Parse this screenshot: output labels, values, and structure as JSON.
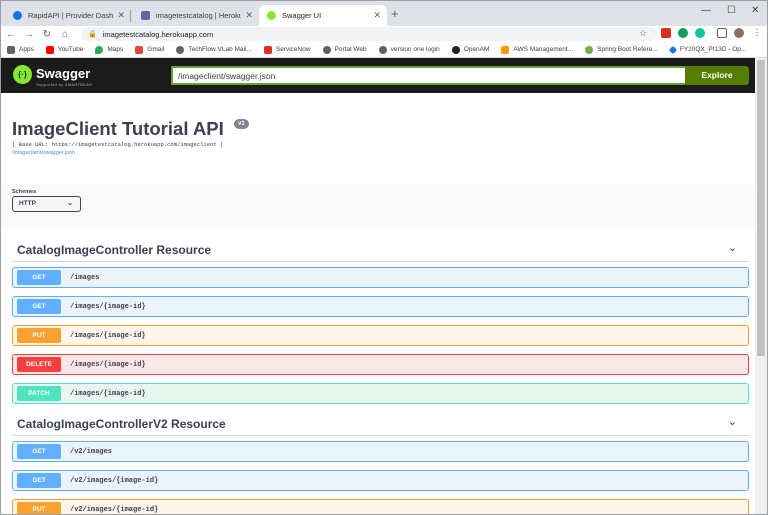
{
  "browser": {
    "tabs": [
      {
        "title": "RapidAPI | Provider Dashboard",
        "icon": "rapidapi-icon",
        "color": "#1a73e8"
      },
      {
        "title": "imagetestcatalog | Heroku",
        "icon": "heroku-icon",
        "color": "#6762a6"
      },
      {
        "title": "Swagger UI",
        "icon": "swagger-icon",
        "color": "#85ea2d"
      }
    ],
    "new_tab": "+",
    "window_controls": {
      "minimize": "—",
      "maximize": "☐",
      "close": "✕"
    },
    "nav": {
      "back": "←",
      "forward": "→",
      "reload": "↻",
      "home": "⌂"
    },
    "url": "imagetestcatalog.herokuapp.com"
  },
  "bookmarks": [
    {
      "label": "Apps",
      "icon": "apps-grid-icon",
      "color": "#5f6368"
    },
    {
      "label": "YouTube",
      "icon": "youtube-icon",
      "color": "#ff0000"
    },
    {
      "label": "Maps",
      "icon": "maps-icon",
      "color": "#34a853"
    },
    {
      "label": "Gmail",
      "icon": "gmail-icon",
      "color": "#ea4335"
    },
    {
      "label": "TechFlow VLab Mail...",
      "icon": "globe-icon",
      "color": "#5f6368"
    },
    {
      "label": "ServiceNow",
      "icon": "servicenow-icon",
      "color": "#d93025"
    },
    {
      "label": "Portal Web",
      "icon": "globe-icon",
      "color": "#5f6368"
    },
    {
      "label": "version one login",
      "icon": "globe-icon",
      "color": "#5f6368"
    },
    {
      "label": "OpenAM",
      "icon": "openam-icon",
      "color": "#202124"
    },
    {
      "label": "AWS Management...",
      "icon": "aws-icon",
      "color": "#ff9900"
    },
    {
      "label": "Spring Boot Refere...",
      "icon": "spring-icon",
      "color": "#6db33f"
    },
    {
      "label": "FY20QX_PI13D - Op...",
      "icon": "diamond-icon",
      "color": "#1a73e8"
    }
  ],
  "swagger": {
    "brand": "Swagger",
    "brand_sub": "Supported by SMARTBEAR",
    "spec_url": "/imageclient/swagger.json",
    "explore_label": "Explore"
  },
  "info": {
    "title": "ImageClient Tutorial API",
    "version": "v1",
    "base_url": "[ Base URL:  https://imagetestcatalog.herokuapp.com/imageclient ]",
    "spec_link": "/imageclient/swagger.json"
  },
  "schemes": {
    "label": "Schemes",
    "selected": "HTTP"
  },
  "controllers": [
    {
      "name": "CatalogImageController Resource",
      "operations": [
        {
          "method": "GET",
          "path": "/images"
        },
        {
          "method": "GET",
          "path": "/images/{image-id}"
        },
        {
          "method": "PUT",
          "path": "/images/{image-id}"
        },
        {
          "method": "DELETE",
          "path": "/images/{image-id}"
        },
        {
          "method": "PATCH",
          "path": "/images/{image-id}"
        }
      ]
    },
    {
      "name": "CatalogImageControllerV2 Resource",
      "operations": [
        {
          "method": "GET",
          "path": "/v2/images"
        },
        {
          "method": "GET",
          "path": "/v2/images/{image-id}"
        },
        {
          "method": "PUT",
          "path": "/v2/images/{image-id}"
        }
      ]
    }
  ],
  "colors": {
    "get": "#61affe",
    "put": "#fca130",
    "delete": "#f93e3e",
    "patch": "#50e3c2",
    "swagger_bar": "#1b1b1b",
    "explore": "#547f00"
  }
}
